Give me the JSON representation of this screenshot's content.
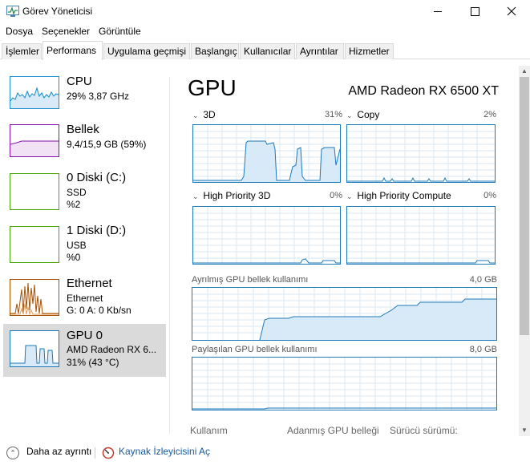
{
  "window": {
    "title": "Görev Yöneticisi"
  },
  "menu": [
    "Dosya",
    "Seçenekler",
    "Görüntüle"
  ],
  "tabs": [
    "İşlemler",
    "Performans",
    "Uygulama geçmişi",
    "Başlangıç",
    "Kullanıcılar",
    "Ayrıntılar",
    "Hizmetler"
  ],
  "active_tab": "Performans",
  "sidebar": [
    {
      "title": "CPU",
      "lines": [
        "29% 3,87 GHz"
      ]
    },
    {
      "title": "Bellek",
      "lines": [
        "9,4/15,9 GB (59%)"
      ]
    },
    {
      "title": "0 Diski (C:)",
      "lines": [
        "SSD",
        "%2"
      ]
    },
    {
      "title": "1 Diski (D:)",
      "lines": [
        "USB",
        "%0"
      ]
    },
    {
      "title": "Ethernet",
      "lines": [
        "Ethernet",
        "G: 0 A: 0 Kb/sn"
      ]
    },
    {
      "title": "GPU 0",
      "lines": [
        "AMD Radeon RX 6...",
        "31% (43 °C)"
      ]
    }
  ],
  "selected_item": "GPU 0",
  "gpu": {
    "title": "GPU",
    "model": "AMD Radeon RX 6500 XT",
    "engines": [
      {
        "name": "3D",
        "percent": "31%"
      },
      {
        "name": "Copy",
        "percent": "2%"
      },
      {
        "name": "High Priority 3D",
        "percent": "0%"
      },
      {
        "name": "High Priority Compute",
        "percent": "0%"
      }
    ],
    "dedicated_memory": {
      "label": "Ayrılmış GPU bellek kullanımı",
      "max": "4,0 GB"
    },
    "shared_memory": {
      "label": "Paylaşılan GPU bellek kullanımı",
      "max": "8,0 GB"
    },
    "stats_labels": [
      "Kullanım",
      "Adanmış GPU belleği",
      "Sürücü sürümü:"
    ]
  },
  "footer": {
    "fewer_details": "Daha az ayrıntı",
    "resource_monitor": "Kaynak İzleyicisini Aç"
  },
  "colors": {
    "gpu_accent": "#1c7ab8",
    "cpu_accent": "#1f8fd0",
    "memory_accent": "#8b12ae",
    "disk_accent": "#4da60c",
    "ethernet_accent": "#a74f01",
    "selected_bg": "#dadada"
  }
}
